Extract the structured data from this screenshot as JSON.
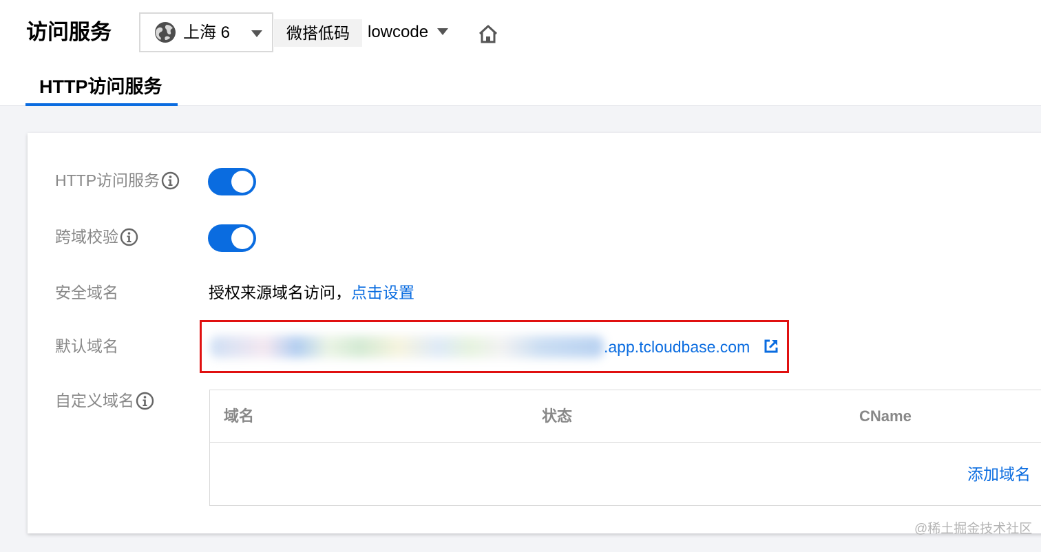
{
  "header": {
    "title": "访问服务",
    "region": "上海 6",
    "env_tag": "微搭低码",
    "env_name": "lowcode"
  },
  "tabs": [
    {
      "label": "HTTP访问服务",
      "active": true
    }
  ],
  "settings": {
    "http_service": {
      "label": "HTTP访问服务",
      "enabled": true
    },
    "cors_check": {
      "label": "跨域校验",
      "enabled": true
    },
    "safe_domain": {
      "label": "安全域名",
      "text": "授权来源域名访问，",
      "link": "点击设置"
    },
    "default_domain": {
      "label": "默认域名",
      "suffix": ".app.tcloudbase.com"
    },
    "custom_domain": {
      "label": "自定义域名"
    }
  },
  "custom_domain_table": {
    "columns": [
      "域名",
      "状态",
      "CName"
    ],
    "add_link": "添加域名"
  },
  "watermark": "@稀土掘金技术社区",
  "colors": {
    "accent": "#0a6ce0",
    "highlight": "#e01010",
    "muted_text": "#888888"
  }
}
